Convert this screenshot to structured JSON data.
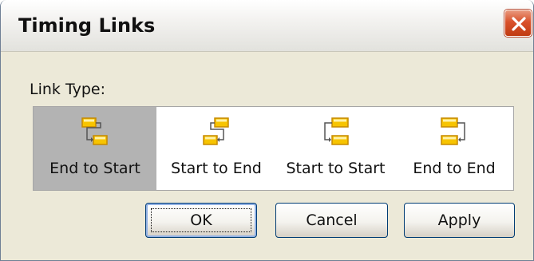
{
  "dialog": {
    "title": "Timing Links"
  },
  "link_type": {
    "label": "Link Type:",
    "selected": "End to Start",
    "options": [
      {
        "label": "End to Start",
        "icon": "end-to-start-icon"
      },
      {
        "label": "Start to End",
        "icon": "start-to-end-icon"
      },
      {
        "label": "Start to Start",
        "icon": "start-to-start-icon"
      },
      {
        "label": "End to End",
        "icon": "end-to-end-icon"
      }
    ]
  },
  "buttons": {
    "ok": "OK",
    "cancel": "Cancel",
    "apply": "Apply"
  },
  "colors": {
    "task_bar": "#f7c400",
    "task_bar_border": "#c58a00",
    "selection": "#b3b3b3",
    "close_button": "#d9512b"
  }
}
